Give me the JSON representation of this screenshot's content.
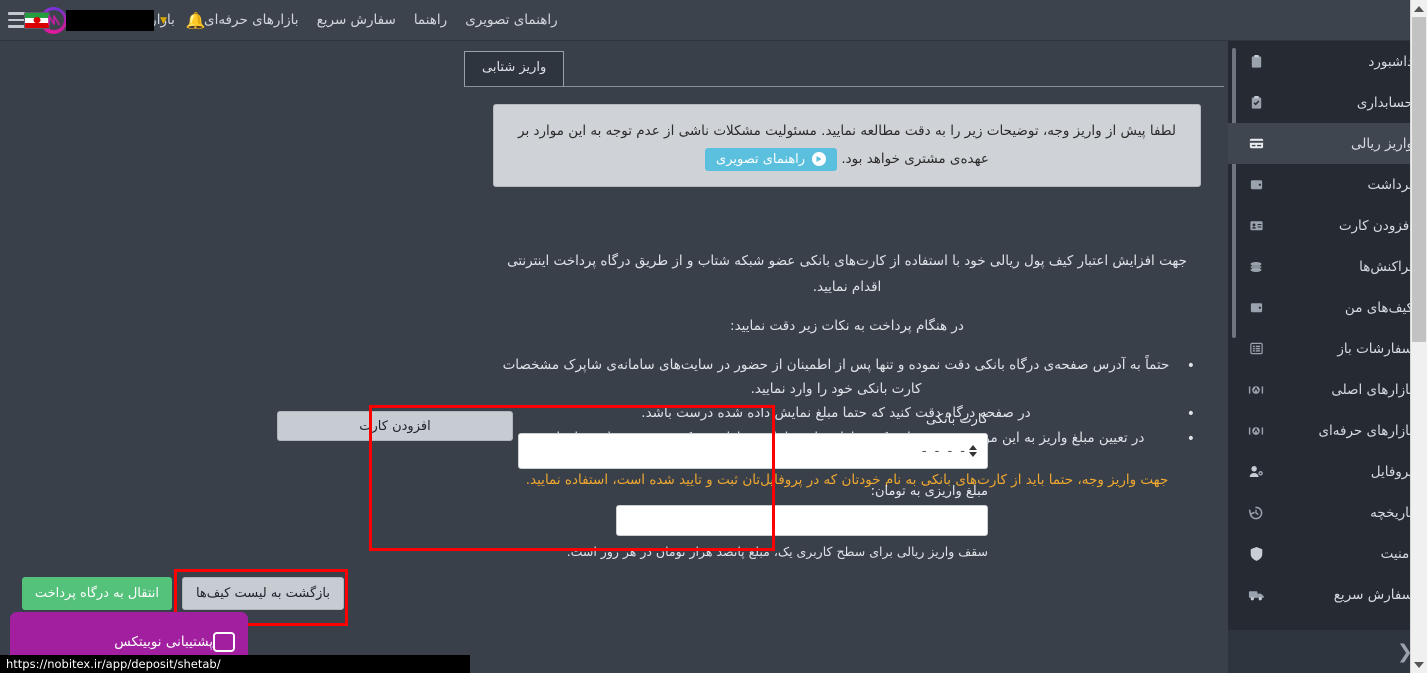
{
  "topnav": {
    "bell_icon": "bell-icon",
    "user_name_redacted": "",
    "logo_label": "nobitex-logo",
    "links": [
      {
        "label": "بازارهای اصلی",
        "has_caret": true
      },
      {
        "label": "بازارهای حرفه‌ای",
        "has_caret": true
      },
      {
        "label": "سفارش سریع",
        "has_caret": false
      },
      {
        "label": "راهنما",
        "has_caret": false
      },
      {
        "label": "راهنمای تصویری",
        "has_caret": false
      }
    ]
  },
  "sidebar": {
    "items": [
      {
        "label": "داشبورد",
        "icon": "clipboard-icon",
        "arrow": "",
        "active": false
      },
      {
        "label": "حسابداری",
        "icon": "clipboard-check-icon",
        "arrow": "⌄",
        "active": false
      },
      {
        "label": "واریز ریالی",
        "icon": "credit-card-icon",
        "arrow": "",
        "active": true
      },
      {
        "label": "برداشت",
        "icon": "wallet-icon",
        "arrow": "",
        "active": false
      },
      {
        "label": "افزودن کارت",
        "icon": "id-card-icon",
        "arrow": "",
        "active": false
      },
      {
        "label": "تراکنش‌ها",
        "icon": "coins-icon",
        "arrow": "",
        "active": false
      },
      {
        "label": "کیف‌های من",
        "icon": "wallet-icon",
        "arrow": "",
        "active": false
      },
      {
        "label": "سفارشات باز",
        "icon": "list-icon",
        "arrow": "",
        "active": false
      },
      {
        "label": "بازارهای اصلی",
        "icon": "chart-icon",
        "arrow": "›",
        "active": false
      },
      {
        "label": "بازارهای حرفه‌ای",
        "icon": "chart-icon",
        "arrow": "›",
        "active": false
      },
      {
        "label": "پروفایل",
        "icon": "user-gear-icon",
        "arrow": "›",
        "active": false
      },
      {
        "label": "تاریخچه",
        "icon": "history-icon",
        "arrow": "›",
        "active": false
      },
      {
        "label": "امنیت",
        "icon": "shield-icon",
        "arrow": "›",
        "active": false
      },
      {
        "label": "سفارش سریع",
        "icon": "truck-icon",
        "arrow": "",
        "active": false
      }
    ],
    "collapse_icon": "chevron-right-icon"
  },
  "main": {
    "tab_label": "واریز شتابی",
    "alert": {
      "text_before": "لطفا پیش از واریز وجه، توضیحات زیر را به دقت مطالعه نمایید. مسئولیت مشکلات ناشی از عدم توجه به این موارد بر عهده‌ی مشتری خواهد بود.",
      "button_label": "راهنمای تصویری"
    },
    "paragraph_1": "جهت افزایش اعتبار کیف پول ریالی خود با استفاده از کارت‌های بانکی عضو شبکه شتاب و از طریق درگاه پرداخت اینترنتی اقدام نمایید.",
    "paragraph_2": "در هنگام پرداخت به نکات زیر دقت نمایید:",
    "bullets": [
      "حتماً به آدرس صفحه‌ی درگاه بانکی دقت نموده و تنها پس از اطمینان از حضور در سایت‌های سامانه‌ی شاپرک مشخصات کارت بانکی خود را وارد نمایید.",
      "در صفحه درگاه دقت کنید که حتما مبلغ نمایش داده شده درست باشد.",
      "در تعیین مبلغ واریز به این موضوع دقت نمایید که حداقل مبلغ معامله در بازار نوبیتکس سیصد هزار تومان است."
    ],
    "warning": "جهت واریز وجه، حتما باید از کارت‌های بانکی به نام خودتان که در پروفایل‌تان ثبت و تایید شده است، استفاده نمایید.",
    "form": {
      "card_label": "کارت بانکی",
      "card_value": "- - - -",
      "amount_label": "مبلغ واریزی به تومان:",
      "amount_value": "",
      "amount_placeholder": "",
      "add_card_button": "افزودن کارت"
    },
    "cap_note": "سقف واریز ریالی برای سطح کاربری یک، مبلغ پانصد هزار تومان در هر روز است.",
    "buttons": {
      "pay": "انتقال به درگاه پرداخت",
      "back": "بازگشت به لیست کیف‌ها"
    }
  },
  "chat": {
    "label": "پشتیبانی نوبیتکس",
    "icon": "chat-bubble-icon"
  },
  "statusbar": {
    "url": "https://nobitex.ir/app/deposit/shetab/"
  },
  "colors": {
    "page_bg": "#394049",
    "sidebar_bg": "#262b33",
    "sidebar_active": "#3f4650",
    "topnav_bg": "#3c434d",
    "accent_green": "#54c27b",
    "accent_blue": "#5bc0de",
    "highlight_red": "#ff0000",
    "warning_orange": "#f0a830",
    "chat_purple": "#a21fa0"
  }
}
